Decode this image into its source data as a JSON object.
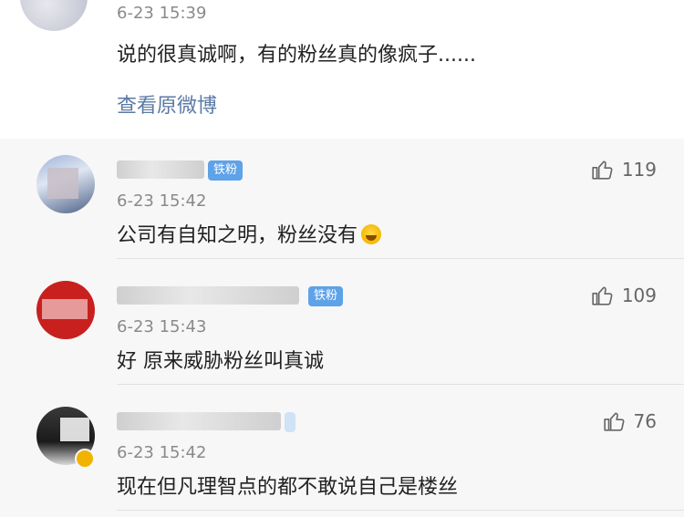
{
  "post": {
    "time": "6-23 15:39",
    "text": "说的很真诚啊，有的粉丝真的像疯子......",
    "view_original": "查看原微博"
  },
  "comments": [
    {
      "time": "6-23 15:42",
      "text": "公司有自知之明，粉丝没有",
      "likes": "119",
      "tag": "铁粉",
      "emoji": "laughing-crying-emoji"
    },
    {
      "time": "6-23 15:43",
      "text": "好 原来威胁粉丝叫真诚",
      "likes": "109",
      "tag": "铁粉"
    },
    {
      "time": "6-23 15:42",
      "text": "现在但凡理智点的都不敢说自己是楼丝",
      "likes": "76"
    }
  ],
  "icons": {
    "like": "thumbs-up-icon"
  },
  "colors": {
    "link": "#5b7aa6",
    "tag": "#5ea2e8",
    "time": "#8a8a8a",
    "comment_bg": "#f7f7f7"
  }
}
